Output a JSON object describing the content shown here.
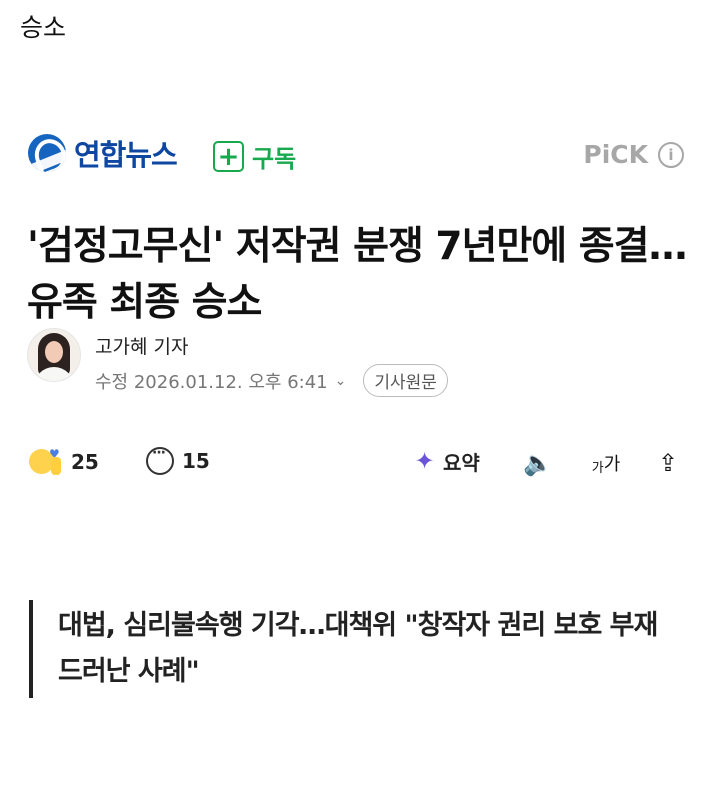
{
  "page": {
    "top_title": "승소"
  },
  "article": {
    "press": {
      "logo_text": "연합뉴스",
      "subscribe_label": "구독",
      "pick_label": "PiCK"
    },
    "headline": "'검정고무신' 저작권 분쟁 7년만에 종결…유족 최종 승소",
    "author": {
      "name": "고가혜 기자",
      "edited_label": "수정",
      "timestamp": "2026.01.12. 오후 6:41",
      "original_label": "기사원문"
    },
    "toolbar": {
      "reaction_count": "25",
      "comment_count": "15",
      "summary_label": "요약",
      "font_small": "가",
      "font_large": "가"
    },
    "quote": "대법, 심리불속행 기각…대책위 \"창작자 권리 보호 부재 드러난 사례\""
  },
  "colors": {
    "accent_green": "#18a84e",
    "brand_blue": "#0d47a1",
    "pick_gray": "#a7a7a7"
  }
}
